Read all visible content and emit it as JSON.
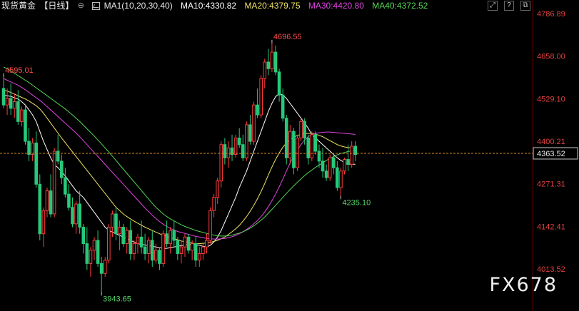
{
  "header": {
    "symbol": "现货黄金",
    "period": "【日线】",
    "ma_setting": "MA1(10,20,30,40)",
    "ma10": "MA10:4330.82",
    "ma20": "MA20:4379.75",
    "ma30": "MA30:4420.80",
    "ma40": "MA40:4372.52"
  },
  "window_controls": [
    "maximize-icon",
    "help-icon",
    "restore-icon"
  ],
  "watermark": "FX678",
  "colors": {
    "up": "#ff3b3b",
    "down": "#26c97a",
    "ma10": "#ffffff",
    "ma20": "#f2e266",
    "ma30": "#e045e0",
    "ma40": "#55d455",
    "current_line": "#d98c2b"
  },
  "chart_data": {
    "type": "candlestick",
    "y_ticks": [
      "4786.89",
      "4658.00",
      "4529.10",
      "4400.21",
      "4271.31",
      "4142.41",
      "4013.52"
    ],
    "y_range": [
      3950,
      4790
    ],
    "current_price": "4363.52",
    "annotations": [
      {
        "text": "4595.01",
        "value": 4595.01,
        "bar": 0
      },
      {
        "text": "4696.55",
        "value": 4696.55,
        "bar": 74
      },
      {
        "text": "4235.10",
        "value": 4235.1,
        "bar": 93
      },
      {
        "text": "3943.65",
        "value": 3943.65,
        "bar": 27
      }
    ],
    "candles_ohlc": [
      [
        4560,
        4595,
        4500,
        4510
      ],
      [
        4510,
        4560,
        4480,
        4530
      ],
      [
        4530,
        4575,
        4480,
        4500
      ],
      [
        4500,
        4545,
        4470,
        4520
      ],
      [
        4520,
        4555,
        4450,
        4460
      ],
      [
        4460,
        4505,
        4445,
        4495
      ],
      [
        4495,
        4510,
        4390,
        4400
      ],
      [
        4400,
        4440,
        4340,
        4360
      ],
      [
        4360,
        4410,
        4340,
        4395
      ],
      [
        4395,
        4430,
        4260,
        4270
      ],
      [
        4270,
        4300,
        4100,
        4120
      ],
      [
        4120,
        4200,
        4080,
        4190
      ],
      [
        4190,
        4260,
        4170,
        4250
      ],
      [
        4250,
        4300,
        4170,
        4180
      ],
      [
        4180,
        4380,
        4170,
        4370
      ],
      [
        4370,
        4420,
        4330,
        4340
      ],
      [
        4340,
        4360,
        4270,
        4290
      ],
      [
        4290,
        4320,
        4230,
        4240
      ],
      [
        4240,
        4270,
        4190,
        4200
      ],
      [
        4200,
        4230,
        4140,
        4150
      ],
      [
        4150,
        4220,
        4120,
        4210
      ],
      [
        4210,
        4250,
        4120,
        4140
      ],
      [
        4140,
        4150,
        4060,
        4090
      ],
      [
        4090,
        4140,
        4010,
        4030
      ],
      [
        4030,
        4080,
        3990,
        4070
      ],
      [
        4070,
        4110,
        4040,
        4100
      ],
      [
        4100,
        4130,
        4020,
        4030
      ],
      [
        4030,
        4050,
        3943.65,
        4000
      ],
      [
        4000,
        4050,
        3990,
        4040
      ],
      [
        4040,
        4150,
        4030,
        4140
      ],
      [
        4140,
        4190,
        4110,
        4180
      ],
      [
        4180,
        4200,
        4100,
        4120
      ],
      [
        4120,
        4160,
        4070,
        4140
      ],
      [
        4140,
        4150,
        4080,
        4090
      ],
      [
        4090,
        4140,
        4060,
        4130
      ],
      [
        4130,
        4160,
        4040,
        4060
      ],
      [
        4060,
        4100,
        4040,
        4090
      ],
      [
        4090,
        4120,
        4060,
        4110
      ],
      [
        4110,
        4160,
        4060,
        4080
      ],
      [
        4080,
        4120,
        4040,
        4060
      ],
      [
        4060,
        4110,
        4030,
        4100
      ],
      [
        4100,
        4130,
        4020,
        4040
      ],
      [
        4040,
        4090,
        4030,
        4070
      ],
      [
        4070,
        4080,
        4010,
        4030
      ],
      [
        4030,
        4130,
        4020,
        4120
      ],
      [
        4120,
        4160,
        4080,
        4090
      ],
      [
        4090,
        4140,
        4060,
        4130
      ],
      [
        4130,
        4160,
        4080,
        4100
      ],
      [
        4100,
        4110,
        4040,
        4060
      ],
      [
        4060,
        4100,
        4030,
        4080
      ],
      [
        4080,
        4120,
        4050,
        4110
      ],
      [
        4110,
        4120,
        4060,
        4070
      ],
      [
        4070,
        4100,
        4040,
        4090
      ],
      [
        4090,
        4110,
        4020,
        4040
      ],
      [
        4040,
        4080,
        4020,
        4060
      ],
      [
        4060,
        4090,
        4040,
        4080
      ],
      [
        4080,
        4120,
        4060,
        4100
      ],
      [
        4100,
        4200,
        4090,
        4190
      ],
      [
        4190,
        4240,
        4170,
        4230
      ],
      [
        4230,
        4290,
        4210,
        4280
      ],
      [
        4280,
        4400,
        4260,
        4390
      ],
      [
        4390,
        4410,
        4330,
        4350
      ],
      [
        4350,
        4400,
        4320,
        4380
      ],
      [
        4380,
        4420,
        4340,
        4360
      ],
      [
        4360,
        4420,
        4350,
        4410
      ],
      [
        4410,
        4440,
        4380,
        4390
      ],
      [
        4390,
        4420,
        4340,
        4350
      ],
      [
        4350,
        4460,
        4340,
        4450
      ],
      [
        4450,
        4480,
        4390,
        4400
      ],
      [
        4400,
        4520,
        4390,
        4510
      ],
      [
        4510,
        4560,
        4470,
        4480
      ],
      [
        4480,
        4600,
        4470,
        4590
      ],
      [
        4590,
        4650,
        4560,
        4640
      ],
      [
        4640,
        4680,
        4600,
        4620
      ],
      [
        4620,
        4696.55,
        4610,
        4670
      ],
      [
        4670,
        4690,
        4600,
        4610
      ],
      [
        4610,
        4620,
        4520,
        4540
      ],
      [
        4540,
        4560,
        4460,
        4470
      ],
      [
        4470,
        4480,
        4330,
        4350
      ],
      [
        4350,
        4450,
        4330,
        4430
      ],
      [
        4430,
        4440,
        4300,
        4320
      ],
      [
        4320,
        4420,
        4310,
        4410
      ],
      [
        4410,
        4470,
        4400,
        4460
      ],
      [
        4460,
        4470,
        4390,
        4410
      ],
      [
        4410,
        4420,
        4330,
        4350
      ],
      [
        4350,
        4430,
        4340,
        4420
      ],
      [
        4420,
        4430,
        4360,
        4370
      ],
      [
        4370,
        4390,
        4320,
        4340
      ],
      [
        4340,
        4380,
        4290,
        4310
      ],
      [
        4310,
        4330,
        4280,
        4290
      ],
      [
        4290,
        4360,
        4280,
        4350
      ],
      [
        4350,
        4360,
        4300,
        4320
      ],
      [
        4320,
        4340,
        4250,
        4260
      ],
      [
        4260,
        4320,
        4235.1,
        4310
      ],
      [
        4310,
        4350,
        4300,
        4345
      ],
      [
        4345,
        4390,
        4310,
        4330
      ],
      [
        4330,
        4400,
        4320,
        4385
      ],
      [
        4385,
        4400,
        4340,
        4360
      ]
    ],
    "ma10": [
      4540,
      4538,
      4536,
      4532,
      4528,
      4520,
      4510,
      4495,
      4480,
      4460,
      4430,
      4400,
      4375,
      4350,
      4330,
      4320,
      4308,
      4295,
      4280,
      4265,
      4250,
      4240,
      4230,
      4215,
      4200,
      4185,
      4170,
      4155,
      4140,
      4130,
      4125,
      4120,
      4115,
      4110,
      4105,
      4100,
      4095,
      4090,
      4088,
      4086,
      4084,
      4082,
      4080,
      4078,
      4076,
      4076,
      4078,
      4080,
      4082,
      4084,
      4086,
      4088,
      4087,
      4086,
      4085,
      4082,
      4080,
      4085,
      4095,
      4110,
      4130,
      4155,
      4180,
      4205,
      4230,
      4260,
      4285,
      4310,
      4340,
      4370,
      4400,
      4430,
      4460,
      4490,
      4515,
      4535,
      4545,
      4540,
      4530,
      4515,
      4500,
      4485,
      4470,
      4455,
      4440,
      4420,
      4410,
      4400,
      4390,
      4380,
      4370,
      4360,
      4350,
      4342,
      4336,
      4332,
      4330,
      4330.82
    ],
    "ma20": [
      4555,
      4552,
      4548,
      4543,
      4538,
      4533,
      4528,
      4522,
      4515,
      4508,
      4498,
      4485,
      4470,
      4455,
      4440,
      4425,
      4410,
      4396,
      4382,
      4368,
      4354,
      4340,
      4326,
      4312,
      4298,
      4284,
      4270,
      4256,
      4242,
      4228,
      4214,
      4200,
      4190,
      4180,
      4172,
      4165,
      4158,
      4152,
      4146,
      4140,
      4135,
      4130,
      4125,
      4120,
      4116,
      4112,
      4108,
      4105,
      4102,
      4098,
      4096,
      4094,
      4092,
      4090,
      4090,
      4091,
      4092,
      4094,
      4097,
      4100,
      4105,
      4110,
      4118,
      4126,
      4135,
      4145,
      4158,
      4172,
      4188,
      4206,
      4226,
      4248,
      4272,
      4298,
      4322,
      4345,
      4365,
      4382,
      4395,
      4405,
      4412,
      4418,
      4421,
      4423,
      4424,
      4424,
      4422,
      4418,
      4414,
      4408,
      4402,
      4396,
      4390,
      4386,
      4383,
      4381,
      4380,
      4379.75
    ],
    "ma30": [
      4590,
      4585,
      4580,
      4575,
      4570,
      4563,
      4556,
      4548,
      4540,
      4532,
      4524,
      4515,
      4505,
      4495,
      4485,
      4475,
      4465,
      4455,
      4445,
      4435,
      4425,
      4414,
      4402,
      4390,
      4378,
      4366,
      4354,
      4342,
      4330,
      4318,
      4306,
      4294,
      4282,
      4270,
      4258,
      4246,
      4234,
      4222,
      4210,
      4198,
      4187,
      4176,
      4166,
      4157,
      4149,
      4142,
      4136,
      4131,
      4127,
      4124,
      4121,
      4118,
      4115,
      4112,
      4110,
      4108,
      4106,
      4105,
      4104,
      4104,
      4105,
      4106,
      4108,
      4111,
      4115,
      4120,
      4126,
      4133,
      4141,
      4150,
      4160,
      4172,
      4186,
      4202,
      4220,
      4240,
      4262,
      4286,
      4310,
      4334,
      4356,
      4374,
      4390,
      4404,
      4414,
      4420,
      4424,
      4426,
      4427,
      4428,
      4428,
      4427,
      4426,
      4425,
      4424,
      4423,
      4422,
      4420.8
    ],
    "ma40": [
      4625,
      4620,
      4613,
      4606,
      4599,
      4592,
      4585,
      4578,
      4570,
      4562,
      4554,
      4546,
      4538,
      4530,
      4522,
      4514,
      4506,
      4498,
      4489,
      4480,
      4470,
      4460,
      4449,
      4438,
      4427,
      4416,
      4404,
      4392,
      4380,
      4368,
      4355,
      4342,
      4329,
      4316,
      4303,
      4290,
      4277,
      4264,
      4251,
      4238,
      4225,
      4212,
      4200,
      4190,
      4180,
      4172,
      4165,
      4159,
      4153,
      4147,
      4142,
      4138,
      4134,
      4130,
      4127,
      4124,
      4121,
      4118,
      4116,
      4114,
      4113,
      4113,
      4114,
      4116,
      4119,
      4122,
      4126,
      4131,
      4137,
      4144,
      4152,
      4161,
      4171,
      4182,
      4194,
      4206,
      4218,
      4230,
      4242,
      4254,
      4265,
      4276,
      4286,
      4296,
      4305,
      4313,
      4321,
      4328,
      4335,
      4342,
      4348,
      4354,
      4359,
      4363,
      4366,
      4369,
      4371,
      4372.52
    ]
  }
}
